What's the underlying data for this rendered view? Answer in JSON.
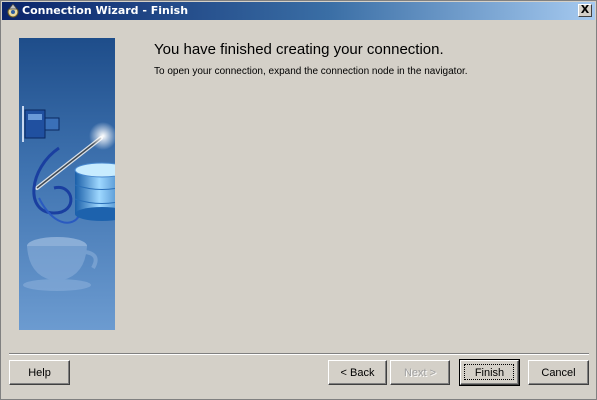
{
  "window": {
    "title": "Connection Wizard - Finish",
    "close_label": "X"
  },
  "content": {
    "heading": "You have finished creating your connection.",
    "instruction": "To open your connection, expand the connection node in the navigator."
  },
  "buttons": {
    "help": "Help",
    "back": "< Back",
    "next": "Next >",
    "finish": "Finish",
    "cancel": "Cancel"
  },
  "icons": {
    "app": "wizard-icon",
    "close": "close-icon",
    "illustration": "connection-database-illustration"
  },
  "colors": {
    "titlebar_start": "#0a246a",
    "titlebar_end": "#a6caf0",
    "dialog_bg": "#d4d0c8",
    "panel_blue": "#3f73b0"
  }
}
